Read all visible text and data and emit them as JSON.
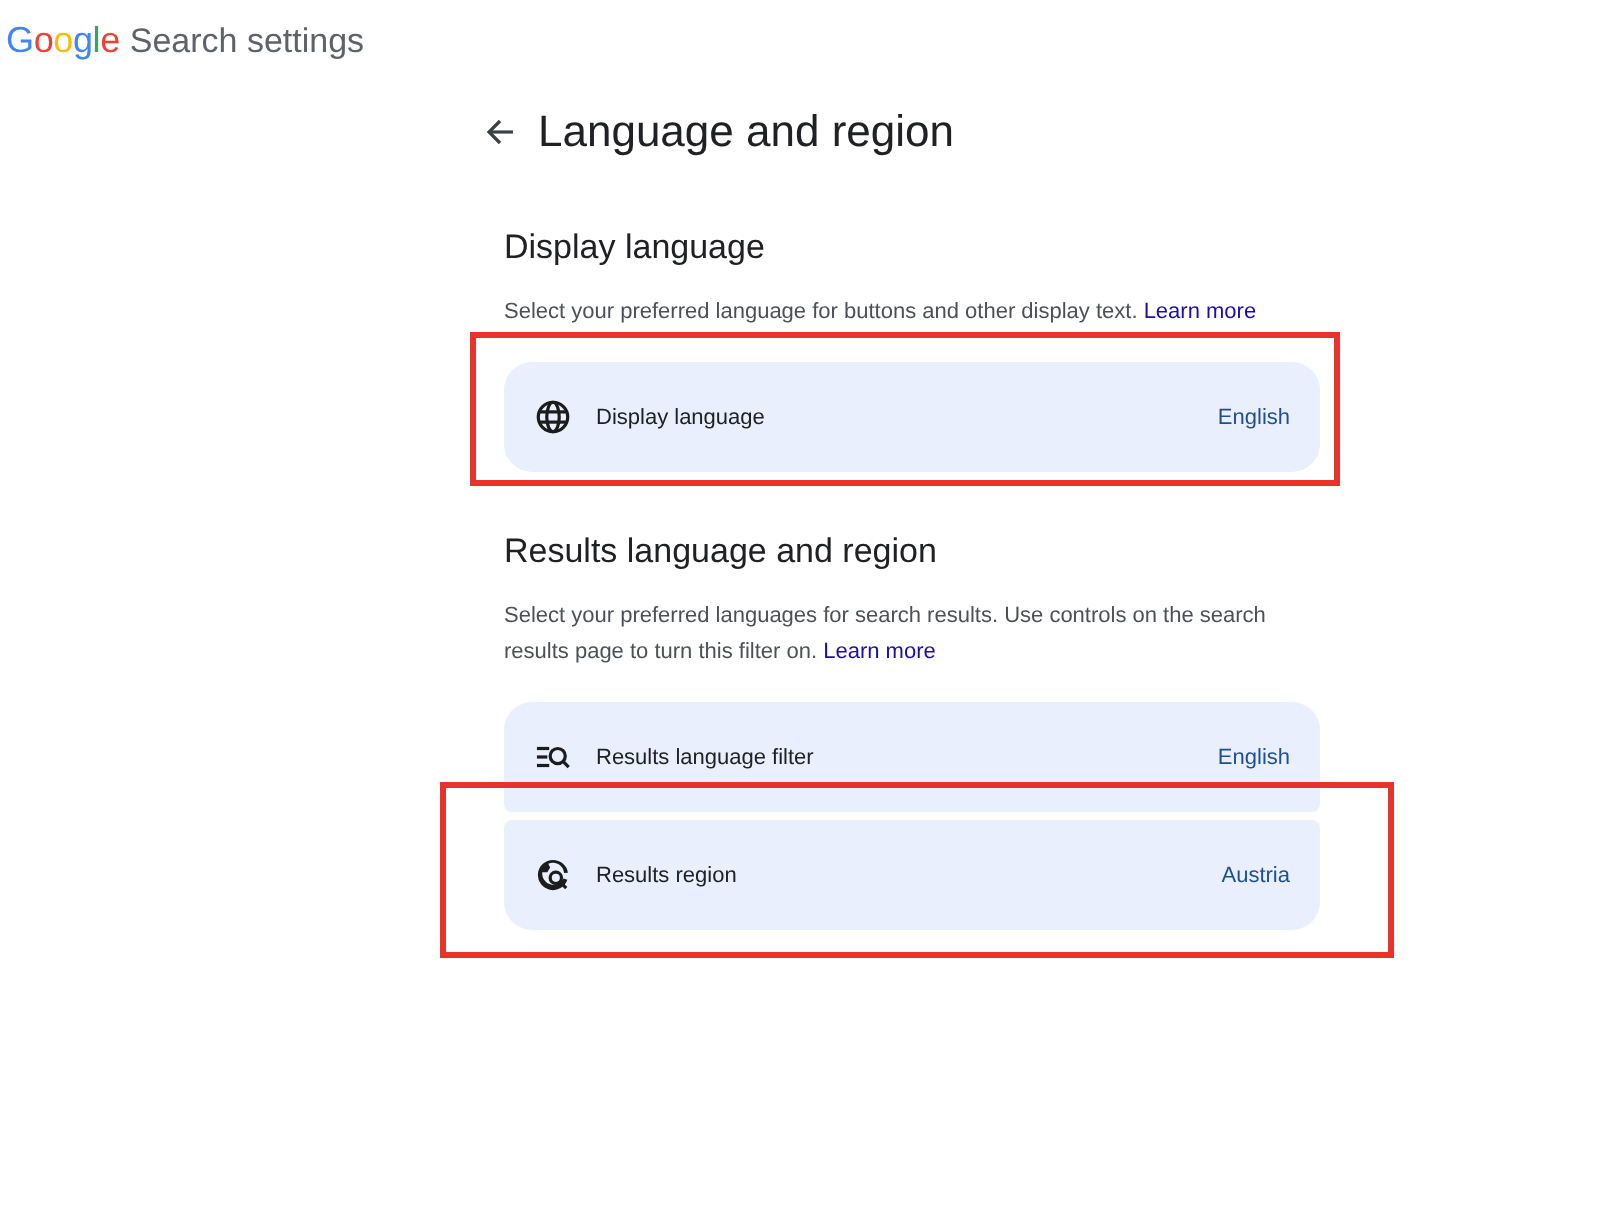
{
  "header": {
    "logo": "Google",
    "title": "Search settings"
  },
  "page": {
    "title": "Language and region"
  },
  "sections": [
    {
      "heading": "Display language",
      "description": "Select your preferred language for buttons and other display text.",
      "link": "Learn more",
      "rows": [
        {
          "kind": "globe",
          "label": "Display language",
          "value": "English",
          "highlighted": true
        }
      ]
    },
    {
      "heading": "Results language and region",
      "description": "Select your preferred languages for search results. Use controls on the search results page to turn this filter on.",
      "link": "Learn more",
      "rows": [
        {
          "kind": "filter",
          "label": "Results language filter",
          "value": "English",
          "highlighted": false
        },
        {
          "kind": "region",
          "label": "Results region",
          "value": "Austria",
          "highlighted": true
        }
      ]
    }
  ]
}
